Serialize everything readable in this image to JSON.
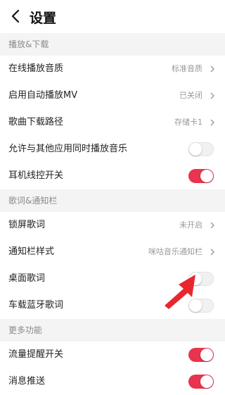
{
  "header": {
    "title": "设置",
    "back_icon": "chevron-left-icon"
  },
  "sections": [
    {
      "title": "播放&下载",
      "rows": [
        {
          "label": "在线播放音质",
          "value": "标准音质",
          "control": "chevron"
        },
        {
          "label": "启用自动播放MV",
          "value": "已关闭",
          "control": "chevron"
        },
        {
          "label": "歌曲下载路径",
          "value": "存储卡1",
          "control": "chevron"
        },
        {
          "label": "允许与其他应用同时播放音乐",
          "value": "",
          "control": "toggle",
          "on": false
        },
        {
          "label": "耳机线控开关",
          "value": "",
          "control": "toggle",
          "on": true
        }
      ]
    },
    {
      "title": "歌词&通知栏",
      "rows": [
        {
          "label": "锁屏歌词",
          "value": "未开启",
          "control": "chevron"
        },
        {
          "label": "通知栏样式",
          "value": "咪咕音乐通知栏",
          "control": "chevron"
        },
        {
          "label": "桌面歌词",
          "value": "",
          "control": "toggle",
          "on": false
        },
        {
          "label": "车载蓝牙歌词",
          "value": "",
          "control": "toggle",
          "on": false
        }
      ]
    },
    {
      "title": "更多功能",
      "rows": [
        {
          "label": "流量提醒开关",
          "value": "",
          "control": "toggle",
          "on": true
        },
        {
          "label": "消息推送",
          "value": "",
          "control": "toggle",
          "on": true
        }
      ]
    }
  ],
  "colors": {
    "accent": "#e8344e",
    "arrow": "#e8262e",
    "background": "#f4f4f4"
  },
  "annotation": {
    "icon": "red-arrow-icon",
    "points_to": "桌面歌词"
  }
}
